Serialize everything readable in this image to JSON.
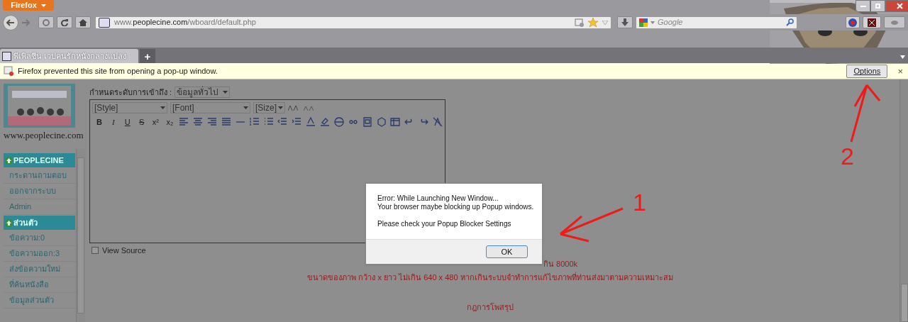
{
  "browser": {
    "menu_button": "Firefox",
    "url": "www.**peoplecine.com**/wboard/default.php",
    "search_placeholder": "Google",
    "tabs": [
      {
        "title": "พีเพิลซีน เวปคนรักหนังกลางแปลง",
        "selected": true
      }
    ],
    "new_tab": "+"
  },
  "notification": {
    "message": "Firefox prevented this site from opening a pop-up window.",
    "button": "Options",
    "close": "×"
  },
  "sidebar": {
    "site_text": "www.peoplecine.com",
    "menu": [
      {
        "label": "PEOPLECINE",
        "kind": "header"
      },
      {
        "label": "กระดานถามตอบ",
        "kind": "item"
      },
      {
        "label": "ออกจากระบบ",
        "kind": "item"
      },
      {
        "label": "Admin",
        "kind": "item"
      },
      {
        "label": "ส่วนตัว",
        "kind": "header"
      },
      {
        "label": "ข้อความ:0",
        "kind": "item"
      },
      {
        "label": "ข้อความออก:3",
        "kind": "item"
      },
      {
        "label": "ส่งข้อความใหม่",
        "kind": "item"
      },
      {
        "label": "ที่ค้นหนังสือ",
        "kind": "item"
      },
      {
        "label": "ข้อมูลส่วนตัว",
        "kind": "item"
      }
    ]
  },
  "form": {
    "access_label": "กำหนดระดับการเข้าถึง :",
    "access_value": "ข้อมูลทั่วไป",
    "editor": {
      "selects": [
        "[Style]",
        "[Font]",
        "[Size]"
      ],
      "format_buttons": [
        "B",
        "I",
        "U",
        "S",
        "x²",
        "x₂"
      ],
      "view_source": {
        "label": "View Source",
        "checked": false
      }
    }
  },
  "notes": [
    "กิน 8000k",
    "ขนาดของภาพ กว้าง x ยาว ไม่เกิน 640 x 480 หากเกินระบบจำทำการแก้ไขภาพที่ท่านส่งมาตามความเหมาะสม",
    "กฎการโพสรุป"
  ],
  "dialog": {
    "lines": [
      "Error: While Launching New Window...",
      "Your browser maybe blocking up Popup windows."
    ],
    "hint": "Please check your Popup Blocker Settings",
    "button": "OK"
  },
  "annotations": [
    {
      "label": "1"
    },
    {
      "label": "2"
    }
  ]
}
